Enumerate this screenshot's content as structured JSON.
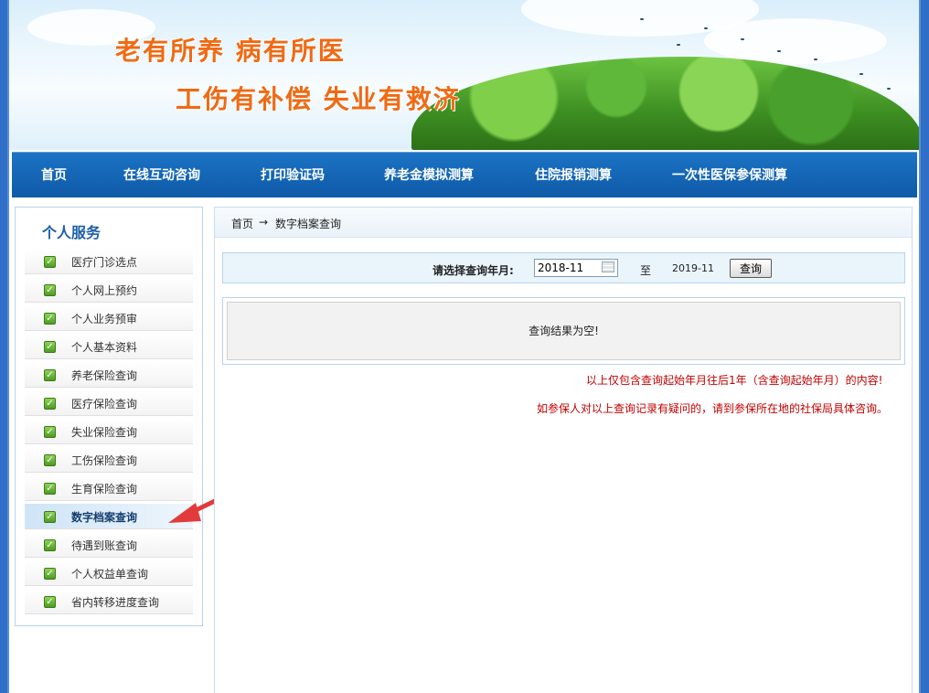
{
  "banner": {
    "slogan_line1": "老有所养  病有所医",
    "slogan_line2": "工伤有补偿  失业有救济"
  },
  "nav": {
    "items": [
      "首页",
      "在线互动咨询",
      "打印验证码",
      "养老金模拟测算",
      "住院报销测算",
      "一次性医保参保测算"
    ]
  },
  "sidebar": {
    "title": "个人服务",
    "items": [
      {
        "label": "医疗门诊选点"
      },
      {
        "label": "个人网上预约"
      },
      {
        "label": "个人业务预审"
      },
      {
        "label": "个人基本资料"
      },
      {
        "label": "养老保险查询"
      },
      {
        "label": "医疗保险查询"
      },
      {
        "label": "失业保险查询"
      },
      {
        "label": "工伤保险查询"
      },
      {
        "label": "生育保险查询"
      },
      {
        "label": "数字档案查询",
        "active": true
      },
      {
        "label": "待遇到账查询"
      },
      {
        "label": "个人权益单查询"
      },
      {
        "label": "省内转移进度查询"
      }
    ]
  },
  "breadcrumb": {
    "home": "首页",
    "separator": "→",
    "current": "数字档案查询"
  },
  "query": {
    "label": "请选择查询年月:",
    "start_value": "2018-11",
    "to_label": "至",
    "end_value": "2019-11",
    "button_label": "查询"
  },
  "result": {
    "empty_text": "查询结果为空!"
  },
  "notes": {
    "line1": "以上仅包含查询起始年月往后1年（含查询起始年月）的内容!",
    "line2": "如参保人对以上查询记录有疑问的，请到参保所在地的社保局具体咨询。"
  },
  "colors": {
    "nav_bg": "#0e5aa8",
    "slogan": "#f06a14",
    "note_red": "#c00000",
    "sidebar_title": "#1d5ea5"
  }
}
